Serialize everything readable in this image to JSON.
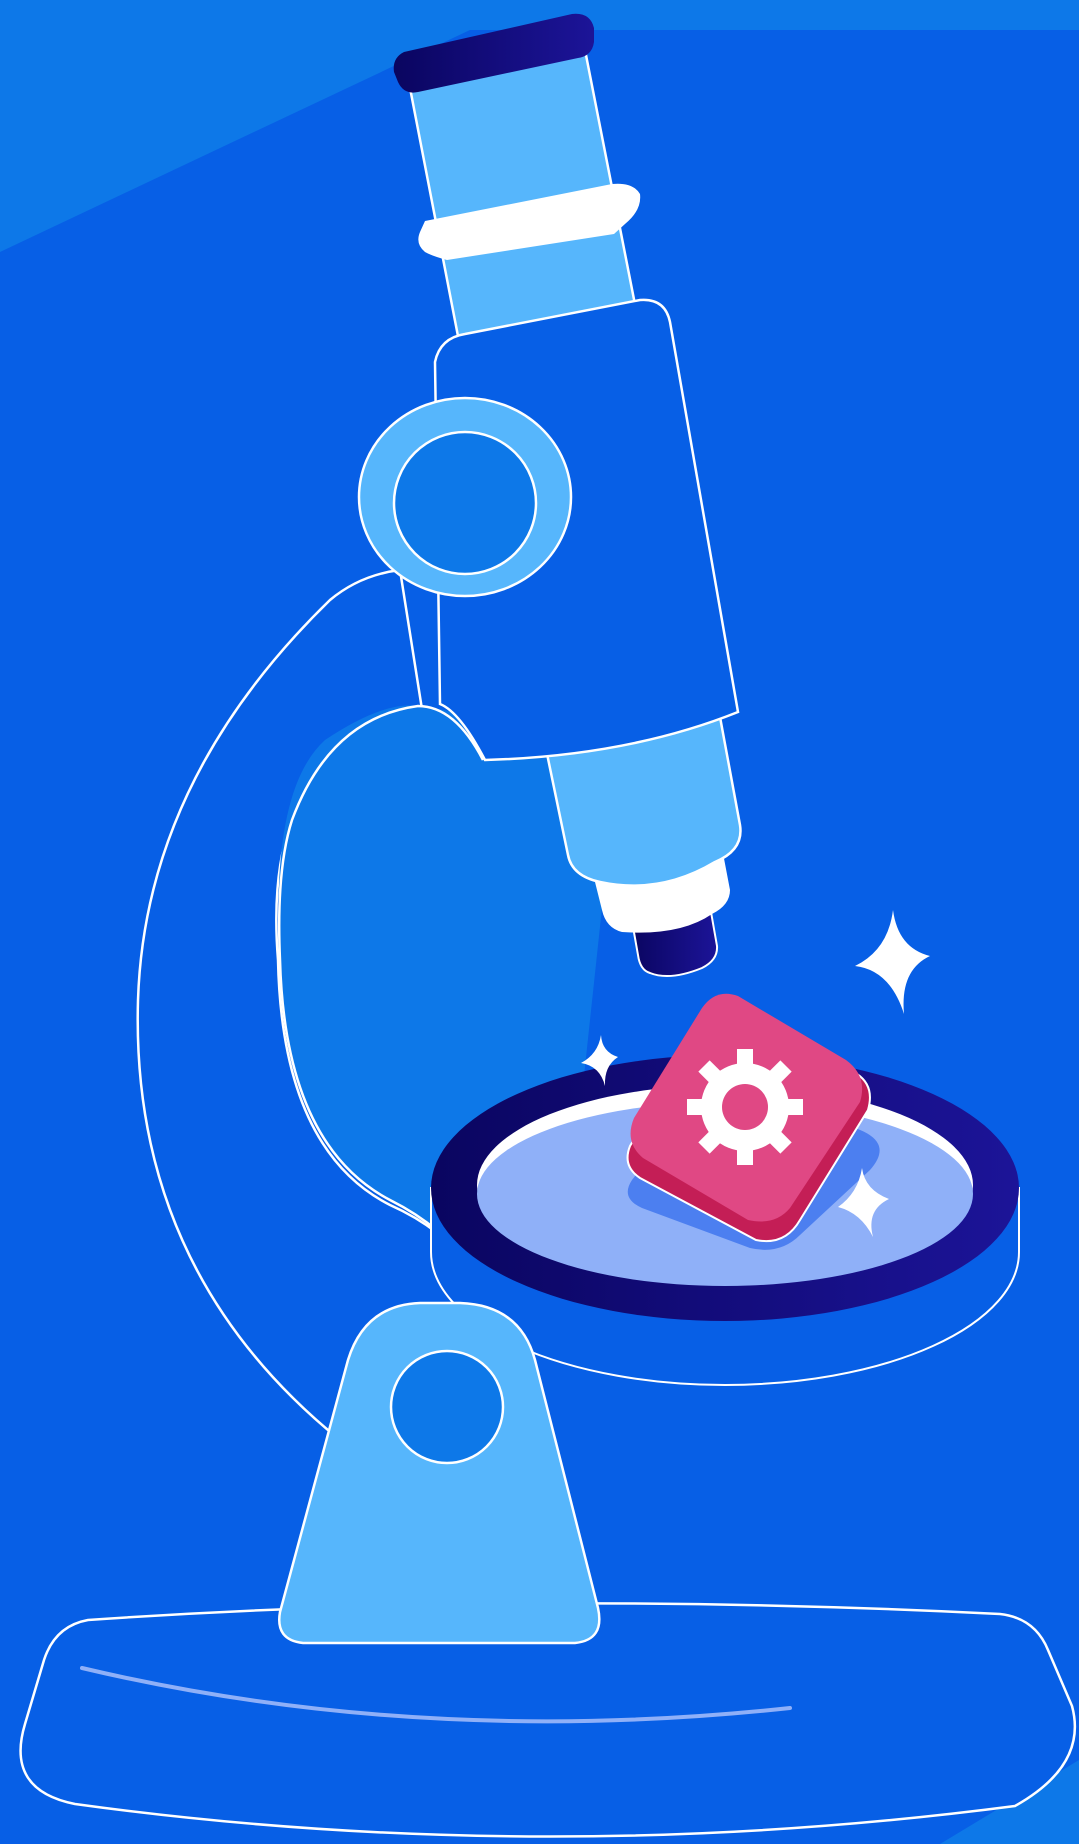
{
  "illustration": {
    "subject": "microscope-inspecting-gear-tile",
    "icons": {
      "slide_icon": "gear-icon",
      "sparkles": [
        "sparkle-icon",
        "sparkle-icon",
        "sparkle-icon"
      ]
    }
  },
  "colors": {
    "background": "#0d78e8",
    "background_shadow": "#075fe6",
    "body_blue": "#075fe6",
    "light_blue": "#56b6fc",
    "mid_blue": "#0d78e8",
    "navy_dark": "#0a0560",
    "navy_light": "#1c1498",
    "stage_disc": "#8fb0f8",
    "tile_pink": "#e04884",
    "tile_pink_dark": "#c41e56",
    "tile_shadow": "#4c7ff0",
    "outline": "#ffffff"
  }
}
